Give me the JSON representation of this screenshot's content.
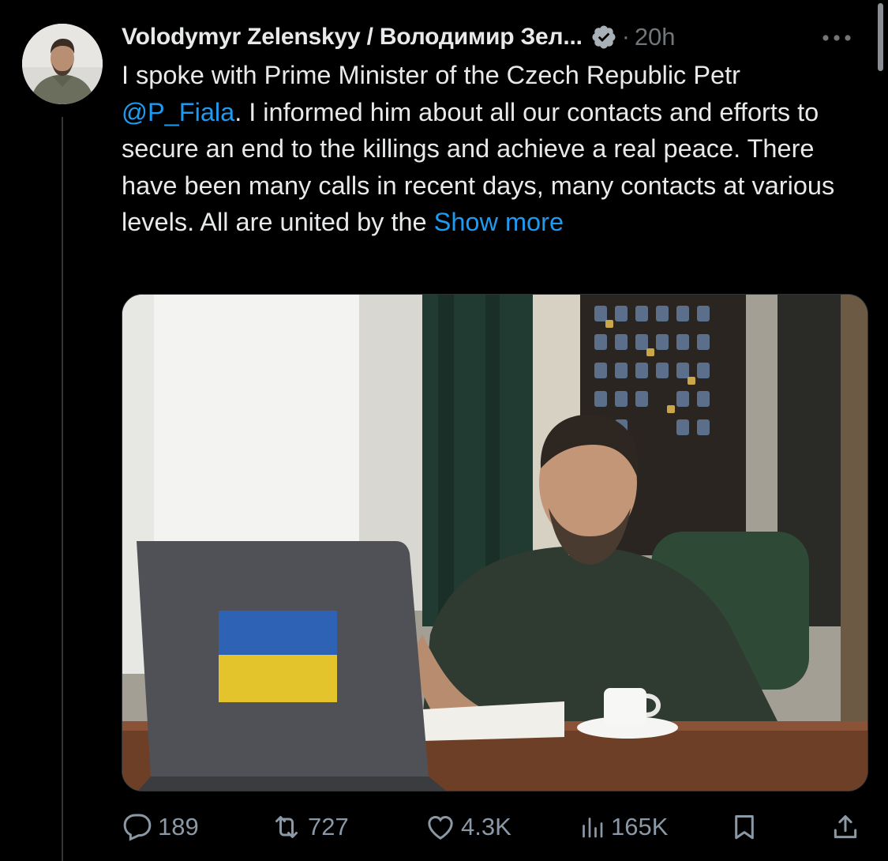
{
  "author": {
    "name": "Volodymyr Zelenskyy / Володимир Зел...",
    "verified": true,
    "time": "20h"
  },
  "tweet": {
    "text_before_mention": "I spoke with Prime Minister of the Czech Republic Petr ",
    "mention": "@P_Fiala",
    "text_after_mention": ". I informed him about all our contacts and efforts to secure an end to the killings and achieve a real peace. There have been many calls in recent days, many contacts at various levels. All are united by the ",
    "show_more": "Show more"
  },
  "media": {
    "alt_icon": "photo-zelensky-laptop-ukrainian-flag"
  },
  "actions": {
    "replies": "189",
    "retweets": "727",
    "likes": "4.3K",
    "views": "165K"
  },
  "colors": {
    "accent": "#1d9bf0",
    "muted": "#71767b",
    "background": "#000000",
    "verified_badge": "#a8b0b8"
  }
}
